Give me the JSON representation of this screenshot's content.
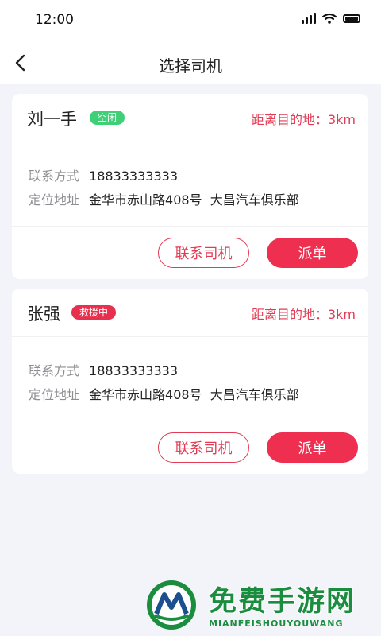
{
  "status_bar": {
    "time": "12:00"
  },
  "nav": {
    "title": "选择司机"
  },
  "drivers": [
    {
      "name": "刘一手",
      "status": "空闲",
      "status_color": "#3fcf77",
      "distance_label": "距离目的地：3km",
      "contact_label": "联系方式",
      "phone": "18833333333",
      "address_label": "定位地址",
      "address": "金华市赤山路408号  大昌汽车俱乐部",
      "contact_button": "联系司机",
      "dispatch_button": "派单"
    },
    {
      "name": "张强",
      "status": "救援中",
      "status_color": "#e8304e",
      "distance_label": "距离目的地：3km",
      "contact_label": "联系方式",
      "phone": "18833333333",
      "address_label": "定位地址",
      "address": "金华市赤山路408号  大昌汽车俱乐部",
      "contact_button": "联系司机",
      "dispatch_button": "派单"
    }
  ],
  "watermark": {
    "title": "免费手游网",
    "subtitle": "MIANFEISHOUYOUWANG"
  },
  "colors": {
    "accent": "#ee2f50",
    "background": "#f3f4f9",
    "idle": "#3fcf77"
  }
}
